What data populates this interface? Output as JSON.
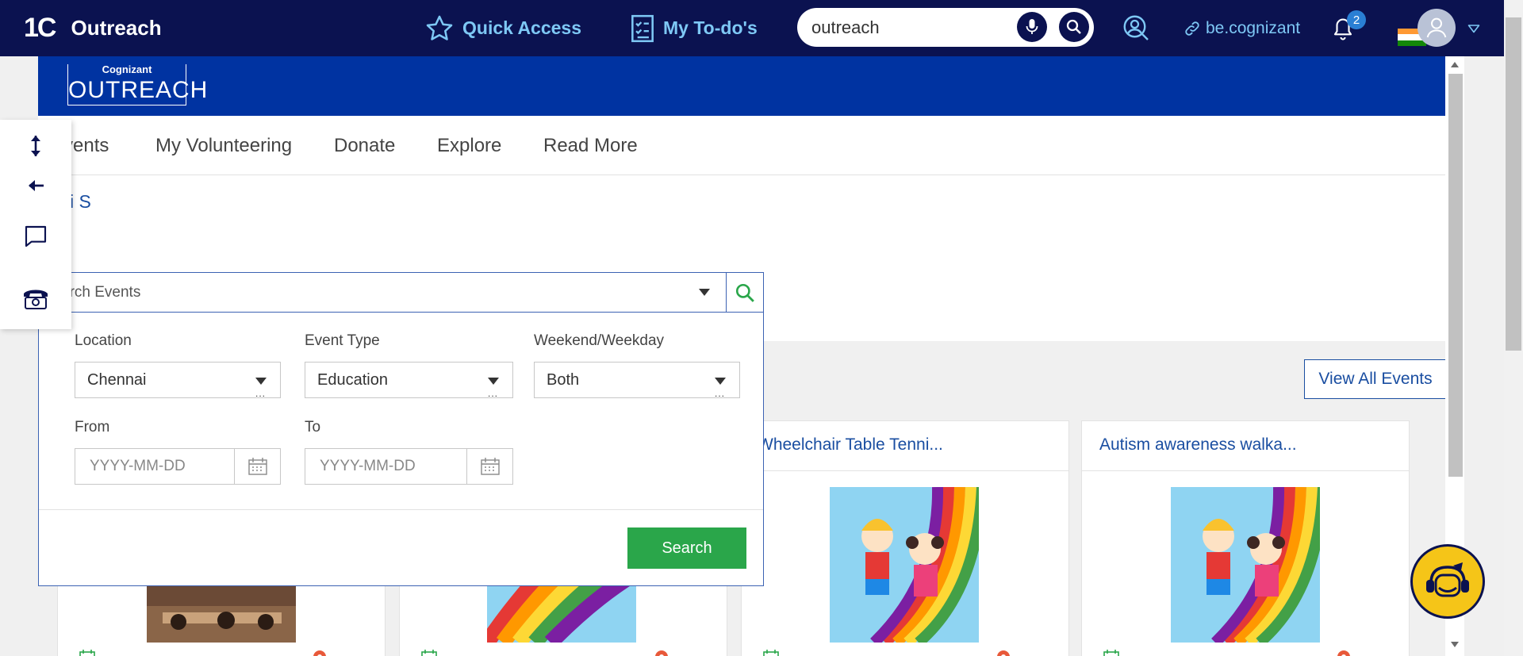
{
  "topbar": {
    "logo": "1C",
    "app_name": "Outreach",
    "quick_access": "Quick Access",
    "my_todos": "My To-do's",
    "search_value": "outreach",
    "be_cognizant": "be.cognizant",
    "notification_count": "2"
  },
  "banner": {
    "logo_top": "Cognizant",
    "logo_bottom": "OUTREACH"
  },
  "subnav": {
    "items": [
      "vents",
      "My Volunteering",
      "Donate",
      "Explore",
      "Read More"
    ]
  },
  "user_link": "i S",
  "event_search": {
    "placeholder": "arch Events",
    "location_label": "Location",
    "location_value": "Chennai",
    "event_type_label": "Event Type",
    "event_type_value": "Education",
    "weekend_label": "Weekend/Weekday",
    "weekend_value": "Both",
    "from_label": "From",
    "to_label": "To",
    "date_placeholder": "YYYY-MM-DD",
    "search_button": "Search"
  },
  "events": {
    "view_all": "View All Events",
    "cards": [
      {
        "title": "Wheelchair Table Tenni..."
      },
      {
        "title": "Autism awareness walka..."
      }
    ]
  },
  "colors": {
    "topbar_bg": "#0b1250",
    "banner_bg": "#0033a1",
    "accent_link": "#1a4ea1",
    "search_green": "#2aa64a"
  }
}
